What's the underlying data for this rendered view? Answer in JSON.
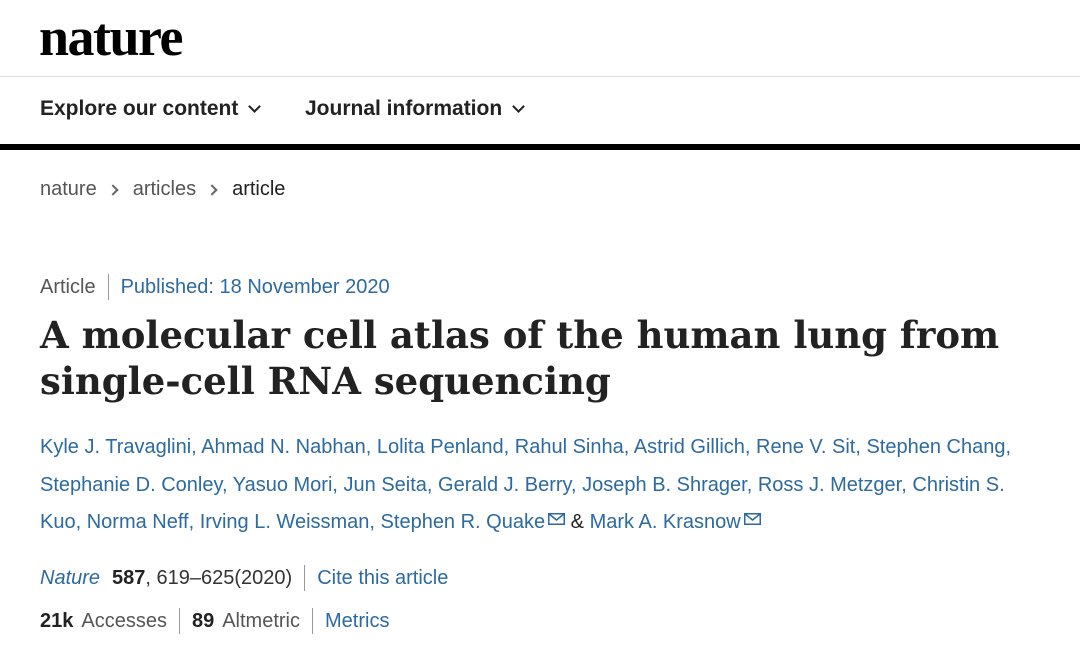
{
  "header": {
    "logo": "nature"
  },
  "nav": {
    "explore": "Explore our content",
    "journal": "Journal information"
  },
  "breadcrumb": {
    "items": [
      "nature",
      "articles",
      "article"
    ]
  },
  "article": {
    "type": "Article",
    "published": "Published: 18 November 2020",
    "title": "A molecular cell atlas of the human lung from single-cell RNA sequencing",
    "authors": [
      "Kyle J. Travaglini",
      "Ahmad N. Nabhan",
      "Lolita Penland",
      "Rahul Sinha",
      "Astrid Gillich",
      "Rene V. Sit",
      "Stephen Chang",
      "Stephanie D. Conley",
      "Yasuo Mori",
      "Jun Seita",
      "Gerald J. Berry",
      "Joseph B. Shrager",
      "Ross J. Metzger",
      "Christin S. Kuo",
      "Norma Neff",
      "Irving L. Weissman",
      "Stephen R. Quake",
      "Mark A. Krasnow"
    ],
    "ampersand": "&",
    "citation": {
      "journal": "Nature",
      "volume": "587",
      "pages": ", 619–625(2020)",
      "cite_link": "Cite this article"
    },
    "metrics": {
      "accesses_count": "21k",
      "accesses_label": "Accesses",
      "altmetric_count": "89",
      "altmetric_label": "Altmetric",
      "metrics_link": "Metrics"
    }
  },
  "icons": {
    "corresponding_author": "envelope-icon"
  },
  "colors": {
    "link": "#2c6aa0",
    "text": "#222222",
    "rule": "#000000"
  }
}
